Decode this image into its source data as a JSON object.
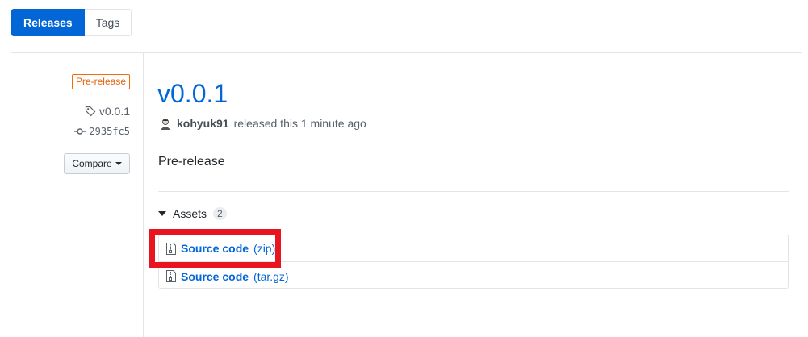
{
  "tabs": [
    {
      "label": "Releases",
      "active": true
    },
    {
      "label": "Tags",
      "active": false
    }
  ],
  "sidebar": {
    "prerelease_label": "Pre-release",
    "tag": "v0.0.1",
    "commit": "2935fc5",
    "compare_label": "Compare"
  },
  "release": {
    "title": "v0.0.1",
    "author": "kohyuk91",
    "released_text": "released this 1 minute ago",
    "body": "Pre-release"
  },
  "assets": {
    "label": "Assets",
    "count": "2",
    "items": [
      {
        "name": "Source code",
        "ext": "(zip)"
      },
      {
        "name": "Source code",
        "ext": "(tar.gz)"
      }
    ]
  },
  "colors": {
    "accent": "#0366d6",
    "prerelease": "#e36209",
    "highlight": "#e8141f"
  }
}
